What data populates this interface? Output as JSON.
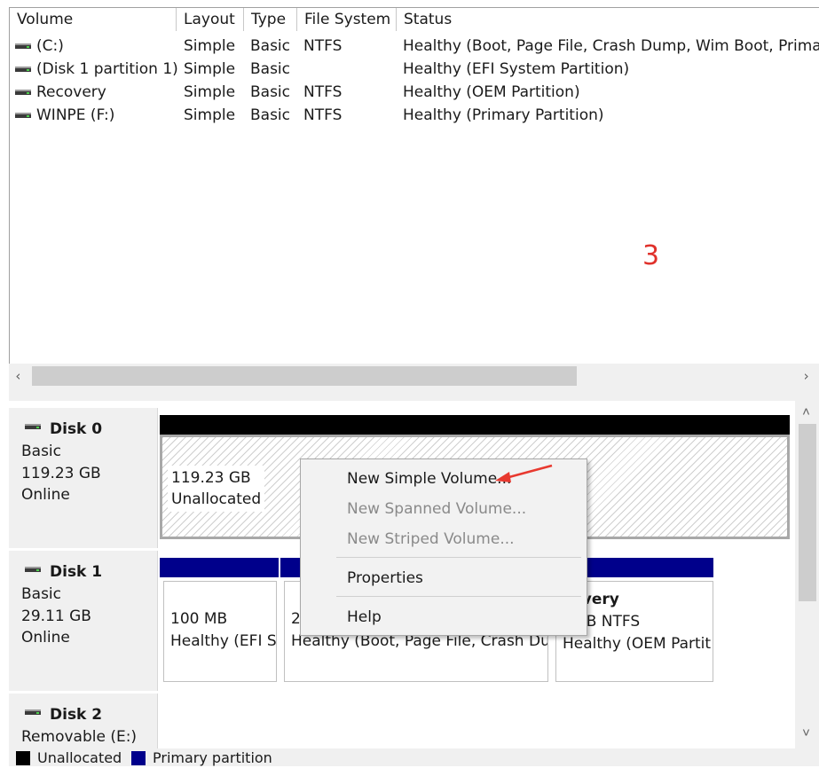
{
  "volume_table": {
    "columns": [
      "Volume",
      "Layout",
      "Type",
      "File System",
      "Status"
    ],
    "rows": [
      {
        "volume": "(C:)",
        "layout": "Simple",
        "type": "Basic",
        "fs": "NTFS",
        "status": "Healthy (Boot, Page File, Crash Dump, Wim Boot, Primary"
      },
      {
        "volume": "(Disk 1 partition 1)",
        "layout": "Simple",
        "type": "Basic",
        "fs": "",
        "status": "Healthy (EFI System Partition)"
      },
      {
        "volume": "Recovery",
        "layout": "Simple",
        "type": "Basic",
        "fs": "NTFS",
        "status": "Healthy (OEM Partition)"
      },
      {
        "volume": "WINPE (F:)",
        "layout": "Simple",
        "type": "Basic",
        "fs": "NTFS",
        "status": "Healthy (Primary Partition)"
      }
    ],
    "scroll_left": "‹",
    "scroll_right": "›"
  },
  "annotation": "3",
  "disks": [
    {
      "name": "Disk 0",
      "kind": "Basic",
      "size": "119.23 GB",
      "state": "Online"
    },
    {
      "name": "Disk 1",
      "kind": "Basic",
      "size": "29.11 GB",
      "state": "Online"
    },
    {
      "name": "Disk 2",
      "kind": "Removable (E:)"
    }
  ],
  "disk0_parts": [
    {
      "size": "119.23 GB",
      "status": "Unallocated"
    }
  ],
  "disk1_parts": [
    {
      "size": "100 MB",
      "status": "Healthy (EFI S"
    },
    {
      "size": "2",
      "status": "Healthy (Boot, Page File, Crash Du"
    },
    {
      "title": "covery",
      "size": ") MB NTFS",
      "status": "Healthy (OEM Partit"
    }
  ],
  "context_menu": {
    "items": [
      {
        "label": "New Simple Volume...",
        "enabled": true
      },
      {
        "label": "New Spanned Volume...",
        "enabled": false
      },
      {
        "label": "New Striped Volume...",
        "enabled": false
      },
      {
        "label": "Properties",
        "enabled": true
      },
      {
        "label": "Help",
        "enabled": true
      }
    ]
  },
  "legend": [
    "Unallocated",
    "Primary partition"
  ],
  "vscroll": {
    "up": "˄",
    "down": "˅"
  },
  "colors": {
    "unallocated": "#000000",
    "primary": "#00008b",
    "annotation": "#e0312b",
    "arrow": "#e8392f"
  }
}
